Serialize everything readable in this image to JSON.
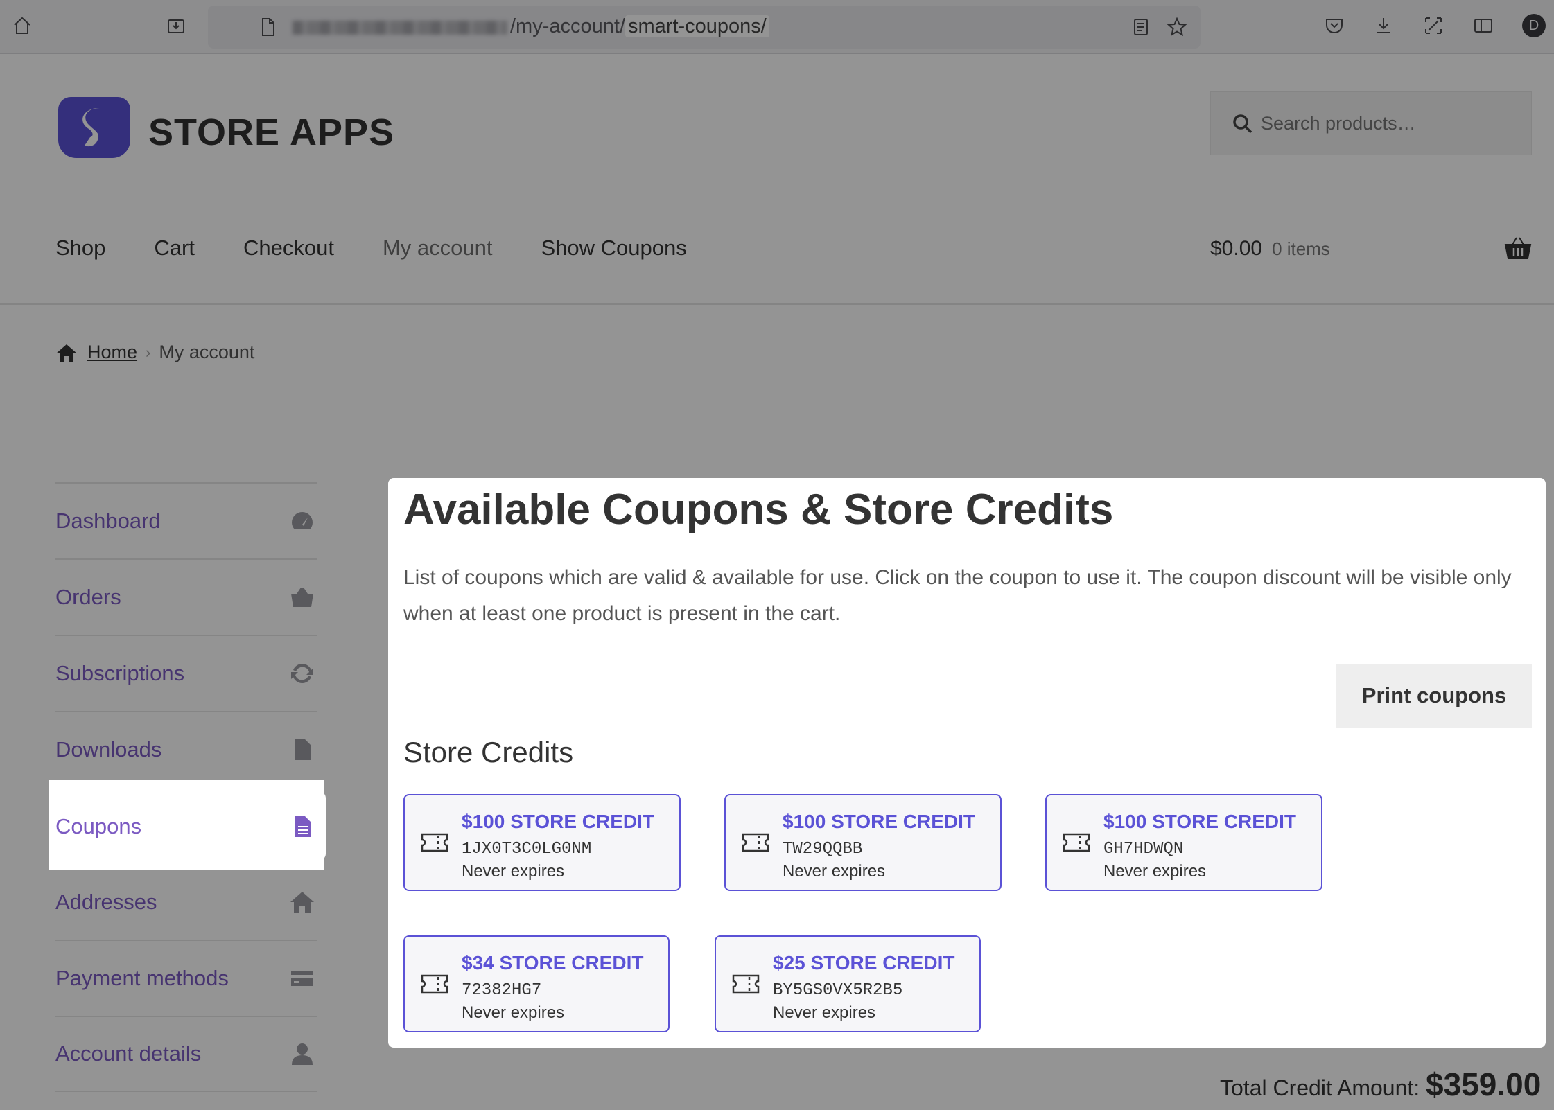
{
  "browser": {
    "url_path": "/my-account/",
    "url_highlight": "smart-coupons/",
    "profile_initial": "D"
  },
  "site": {
    "logo_text": "STORE APPS",
    "search_placeholder": "Search products…",
    "nav": [
      "Shop",
      "Cart",
      "Checkout",
      "My account",
      "Show Coupons"
    ],
    "cart_total": "$0.00",
    "cart_items": "0 items"
  },
  "breadcrumb": {
    "home": "Home",
    "current": "My account"
  },
  "sidebar": {
    "items": [
      {
        "label": "Dashboard",
        "icon": "dashboard-gauge-icon"
      },
      {
        "label": "Orders",
        "icon": "basket-icon"
      },
      {
        "label": "Subscriptions",
        "icon": "refresh-icon"
      },
      {
        "label": "Downloads",
        "icon": "file-download-icon"
      },
      {
        "label": "Coupons",
        "icon": "document-icon"
      },
      {
        "label": "Addresses",
        "icon": "home-icon"
      },
      {
        "label": "Payment methods",
        "icon": "credit-card-icon"
      },
      {
        "label": "Account details",
        "icon": "user-icon"
      }
    ],
    "active": "Coupons"
  },
  "main": {
    "title": "Available Coupons & Store Credits",
    "description": "List of coupons which are valid & available for use. Click on the coupon to use it. The coupon discount will be visible only when at least one product is present in the cart.",
    "print_label": "Print coupons",
    "section_title": "Store Credits",
    "coupons": [
      {
        "amount": "$100 STORE CREDIT",
        "code": "1JX0T3C0LG0NM",
        "expiry": "Never expires"
      },
      {
        "amount": "$100 STORE CREDIT",
        "code": "TW29QQBB",
        "expiry": "Never expires"
      },
      {
        "amount": "$100 STORE CREDIT",
        "code": "GH7HDWQN",
        "expiry": "Never expires"
      },
      {
        "amount": "$34 STORE CREDIT",
        "code": "72382HG7",
        "expiry": "Never expires"
      },
      {
        "amount": "$25 STORE CREDIT",
        "code": "BY5GS0VX5R2B5",
        "expiry": "Never expires"
      }
    ],
    "total_label": "Total Credit Amount:",
    "total_value": "$359.00"
  },
  "colors": {
    "accent": "#5b52d6",
    "link": "#7b5ac2"
  }
}
